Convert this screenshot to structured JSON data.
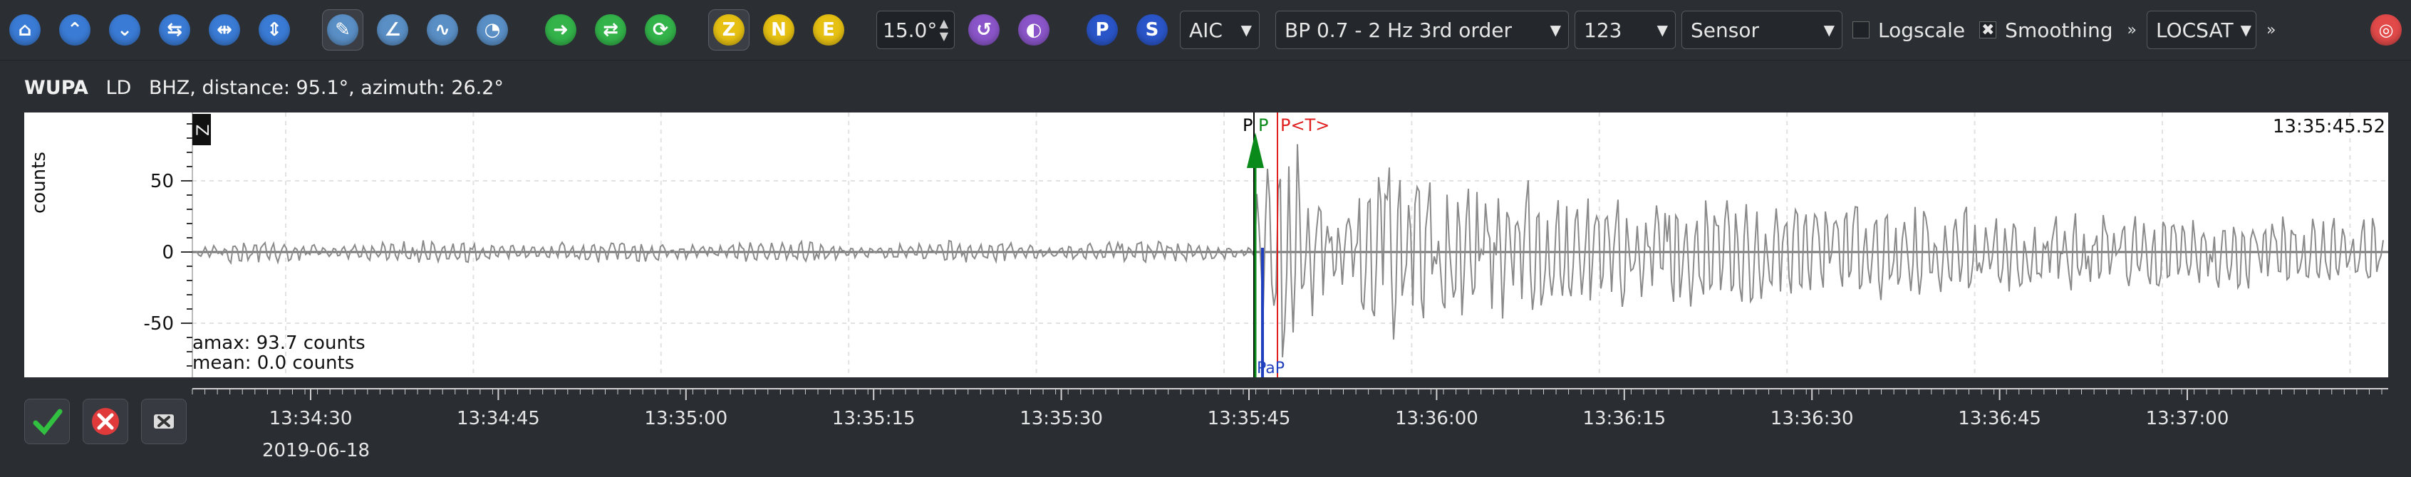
{
  "toolbar": {
    "filter_value": "15.0°",
    "component_buttons": [
      "Z",
      "N",
      "E"
    ],
    "phase_buttons": [
      "P",
      "S"
    ],
    "picker": "AIC",
    "filter": "BP 0.7 - 2 Hz  3rd order",
    "filter_code": "123",
    "unit": "Sensor",
    "logscale_label": "Logscale",
    "smoothing_label": "Smoothing",
    "locator": "LOCSAT",
    "more_glyph": "»"
  },
  "trace_header": {
    "station": "WUPA",
    "network": "LD",
    "channel_info": "BHZ, distance: 95.1°, azimuth: 26.2°"
  },
  "plot": {
    "component_badge": "Z",
    "ylabel": "counts",
    "yticks": [
      "50",
      "0",
      "-50"
    ],
    "amax": "amax: 93.7 counts",
    "mean": "mean: 0.0 counts",
    "time_right": "13:35:45.52",
    "picks_top": [
      "P",
      "P",
      "P<T>"
    ],
    "picks_bottom": "PaP",
    "colors": {
      "pick_black": "#000000",
      "pick_green": "#0a8a1a",
      "pick_red": "#e02020",
      "pick_blue": "#1f3fbf",
      "trace": "#8a8a8a"
    }
  },
  "time_axis": {
    "labels": [
      "13:34:30",
      "13:34:45",
      "13:35:00",
      "13:35:15",
      "13:35:30",
      "13:35:45",
      "13:36:00",
      "13:36:15",
      "13:36:30",
      "13:36:45",
      "13:37:00"
    ],
    "date": "2019-06-18"
  }
}
